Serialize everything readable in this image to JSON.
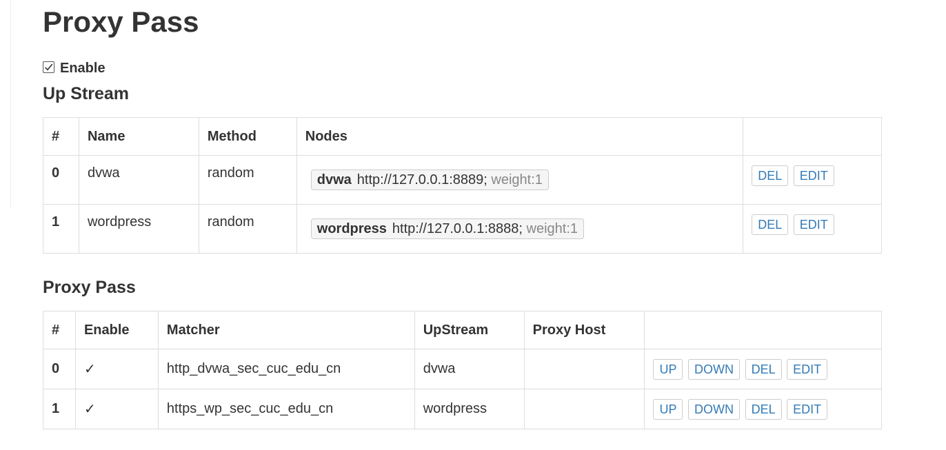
{
  "page": {
    "title": "Proxy Pass"
  },
  "enable": {
    "label": "Enable",
    "checked": true,
    "check_glyph": "✓"
  },
  "upstream": {
    "heading": "Up Stream",
    "columns": [
      "#",
      "Name",
      "Method",
      "Nodes",
      ""
    ],
    "rows": [
      {
        "index": "0",
        "name": "dvwa",
        "method": "random",
        "node": {
          "name": "dvwa",
          "url": "http://127.0.0.1:8889;",
          "weight": "weight:1"
        },
        "actions": [
          "DEL",
          "EDIT"
        ]
      },
      {
        "index": "1",
        "name": "wordpress",
        "method": "random",
        "node": {
          "name": "wordpress",
          "url": "http://127.0.0.1:8888;",
          "weight": "weight:1"
        },
        "actions": [
          "DEL",
          "EDIT"
        ]
      }
    ]
  },
  "proxy": {
    "heading": "Proxy Pass",
    "columns": [
      "#",
      "Enable",
      "Matcher",
      "UpStream",
      "Proxy Host",
      ""
    ],
    "rows": [
      {
        "index": "0",
        "enabled": "✓",
        "matcher": "http_dvwa_sec_cuc_edu_cn",
        "upstream": "dvwa",
        "proxy_host": "",
        "actions": [
          "UP",
          "DOWN",
          "DEL",
          "EDIT"
        ]
      },
      {
        "index": "1",
        "enabled": "✓",
        "matcher": "https_wp_sec_cuc_edu_cn",
        "upstream": "wordpress",
        "proxy_host": "",
        "actions": [
          "UP",
          "DOWN",
          "DEL",
          "EDIT"
        ]
      }
    ]
  },
  "colors": {
    "link": "#337ab7",
    "border": "#dddddd",
    "text": "#333333",
    "muted": "#888888"
  }
}
